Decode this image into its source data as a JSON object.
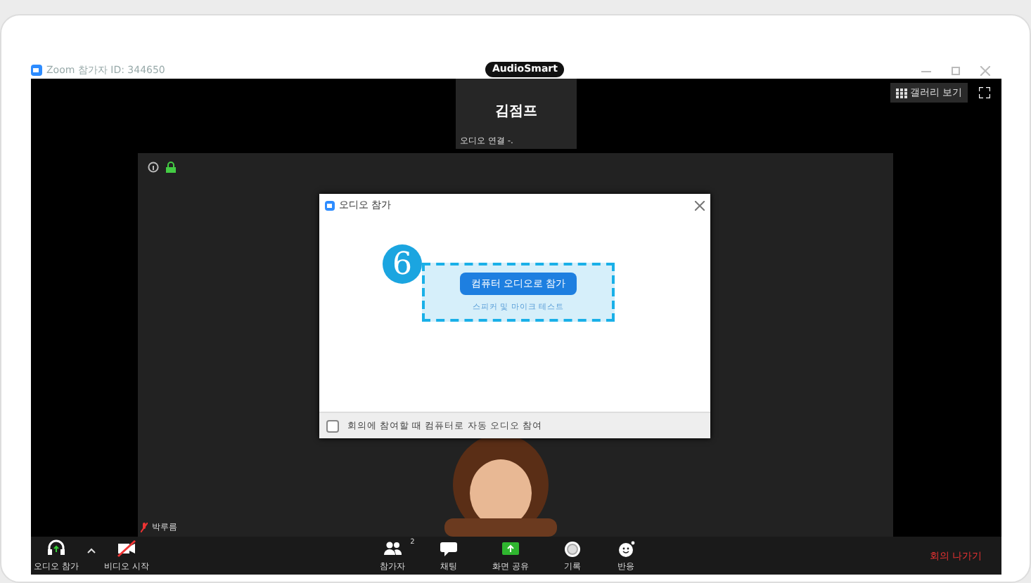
{
  "window": {
    "title": "Zoom 참가자 ID: 344650",
    "badge": "AudioSmart",
    "view_button": "갤러리 보기"
  },
  "speaker_tile": {
    "name": "김점프",
    "status": "오디오 연결 -."
  },
  "self_tile": {
    "name": "박루름"
  },
  "dialog": {
    "title": "오디오 참가",
    "primary_button": "컴퓨터 오디오로 참가",
    "link": "스피커 및 마이크 테스트",
    "callout": "6",
    "checkbox": {
      "label": "회의에 참여할 때 컴퓨터로 자동 오디오 참여",
      "checked": false
    }
  },
  "toolbar": {
    "left": [
      {
        "kind": "headphones",
        "label": "오디오 참가"
      },
      {
        "kind": "video-off",
        "label": "비디오 시작"
      }
    ],
    "center": [
      {
        "kind": "participants",
        "label": "참가자",
        "count": "2"
      },
      {
        "kind": "chat",
        "label": "채팅"
      },
      {
        "kind": "share",
        "label": "화면 공유"
      },
      {
        "kind": "record",
        "label": "기록"
      },
      {
        "kind": "reaction",
        "label": "반응"
      }
    ],
    "leave": "회의 나가기"
  }
}
